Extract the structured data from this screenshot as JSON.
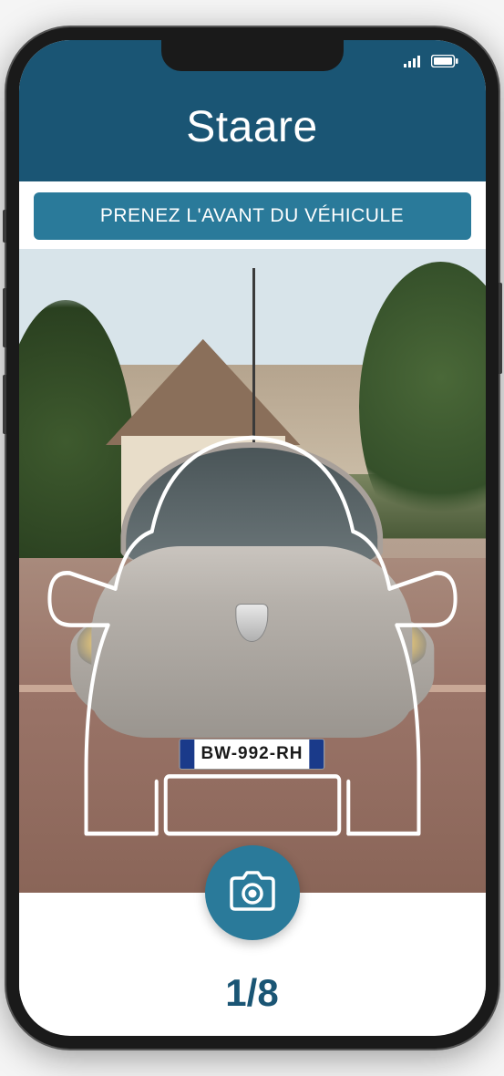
{
  "status": {
    "signal_icon": "signal",
    "battery_icon": "battery"
  },
  "header": {
    "title": "Staare"
  },
  "instruction": {
    "text": "PRENEZ L'AVANT DU VÉHICULE"
  },
  "vehicle": {
    "license_plate": "BW-992-RH"
  },
  "shutter": {
    "icon": "camera"
  },
  "progress": {
    "current": 1,
    "total": 8,
    "display": "1/8"
  },
  "colors": {
    "primary_dark": "#1a5574",
    "primary": "#2a7a9a",
    "white": "#ffffff"
  }
}
